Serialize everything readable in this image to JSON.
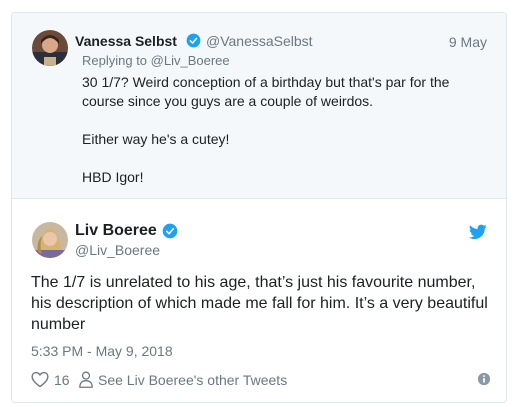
{
  "parent_tweet": {
    "author_name": "Vanessa Selbst",
    "author_handle": "@VanessaSelbst",
    "date": "9 May",
    "replying_prefix": "Replying to",
    "replying_to": "@Liv_Boeree",
    "paragraphs": [
      "30 1/7? Weird conception of a birthday but that's par for the course since you guys are a couple of weirdos.",
      "Either way he's a cutey!",
      "HBD Igor!"
    ]
  },
  "tweet": {
    "author_name": "Liv Boeree",
    "author_handle": "@Liv_Boeree",
    "text": "The 1/7 is unrelated to his age, that’s just his favourite number, his description of which made me fall for him. It’s a very beautiful number",
    "timestamp": "5:33 PM - May 9, 2018",
    "like_count": "16",
    "see_more_label": "See Liv Boeree's other Tweets"
  },
  "icons": {
    "verified": "verified-badge-icon",
    "twitter": "twitter-bird-icon",
    "like": "heart-icon",
    "profile": "person-icon",
    "info": "info-icon"
  },
  "colors": {
    "brand_blue": "#1da1f2",
    "secondary_text": "#697882",
    "primary_text": "#1c2022",
    "parent_bg": "#f5f8fa"
  }
}
